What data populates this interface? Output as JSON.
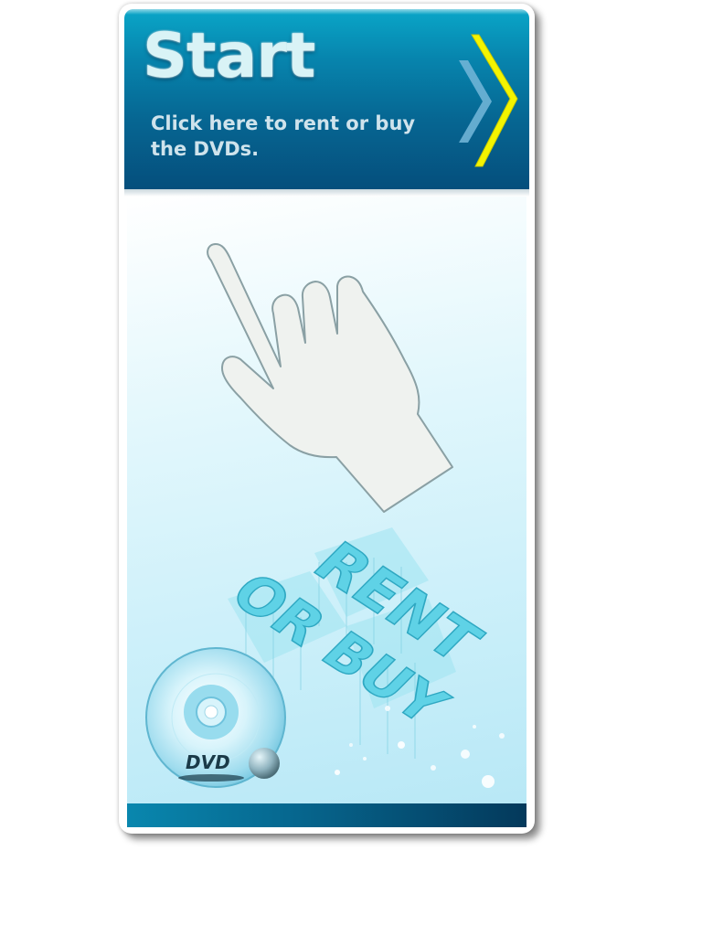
{
  "banner": {
    "title": "Start",
    "subtitle": "Click here to rent or buy the DVDs."
  },
  "artwork": {
    "headline_line1": "RENT",
    "headline_line2": "OR BUY",
    "disc_logo": "DVD"
  },
  "icons": {
    "arrow": "chevron-right-icon",
    "pointer": "pointing-hand-icon",
    "disc": "dvd-disc-icon"
  },
  "colors": {
    "banner_top": "#0aa6c8",
    "banner_bottom": "#054e7c",
    "chevron_yellow": "#f4f400",
    "chevron_blue": "#6fb4d6",
    "letters_cyan": "#5fd2e6"
  }
}
